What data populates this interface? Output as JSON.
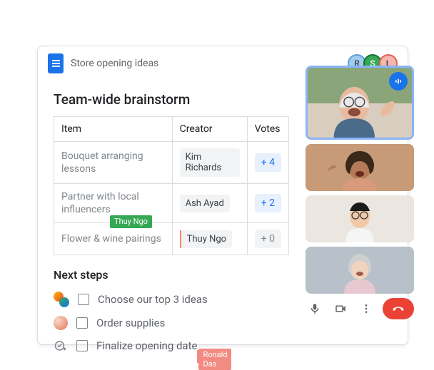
{
  "document": {
    "title": "Store opening ideas",
    "heading": "Team-wide brainstorm",
    "subheading": "Next steps"
  },
  "presence": [
    {
      "initial": "R",
      "bg": "#a0ccef",
      "ring": "#609ed6"
    },
    {
      "initial": "S",
      "bg": "#34a853",
      "ring": "#137333"
    },
    {
      "initial": "L",
      "bg": "#f5b6ac",
      "ring": "#e06055"
    }
  ],
  "table": {
    "headers": {
      "item": "Item",
      "creator": "Creator",
      "votes": "Votes"
    },
    "rows": [
      {
        "item": "Bouquet arranging lessons",
        "creator": "Kim Richards",
        "votes": "+ 4",
        "active": true
      },
      {
        "item": "Partner with local influencers",
        "creator": "Ash Ayad",
        "votes": "+ 2",
        "active": true,
        "tag": "Thuy Ngo"
      },
      {
        "item": "Flower & wine pairings",
        "creator": "Thuy Ngo",
        "votes": "+ 0",
        "active": false
      }
    ]
  },
  "tasks": [
    {
      "label": "Choose our top 3 ideas"
    },
    {
      "label": "Order supplies"
    },
    {
      "label": "Finalize opening date",
      "cursor_tag": "Ronald Das"
    }
  ],
  "collab": {
    "thuy_tag": "Thuy Ngo",
    "ronald_tag": "Ronald Das"
  },
  "meet": {
    "icons": {
      "mic": "mic-icon",
      "cam": "camera-icon",
      "more": "more-icon",
      "end": "end-call"
    }
  }
}
